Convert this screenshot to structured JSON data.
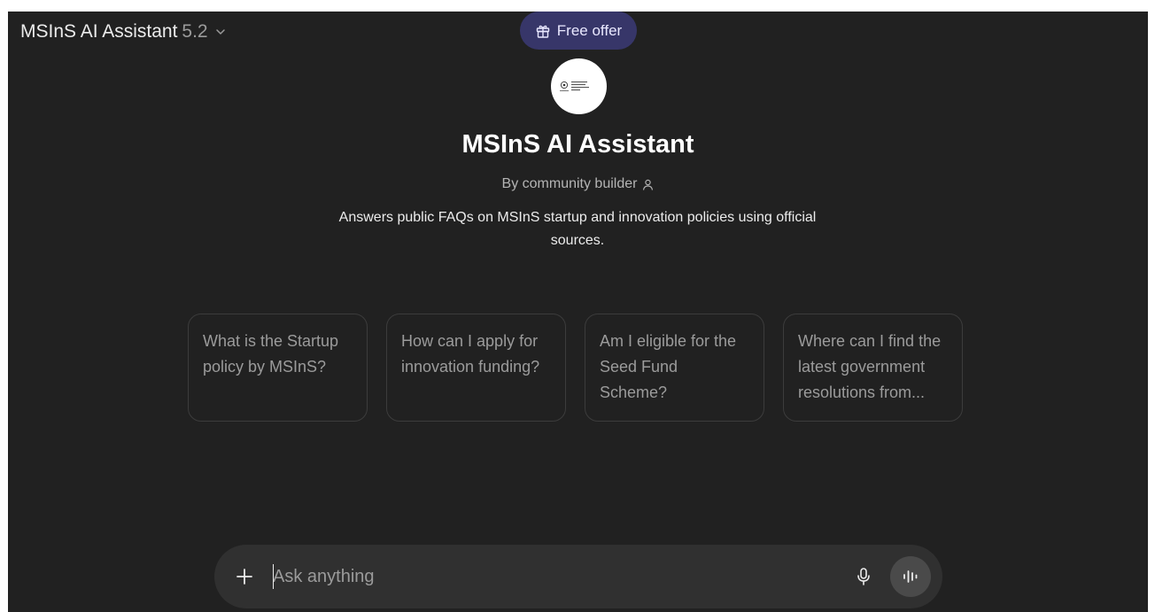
{
  "header": {
    "model_name": "MSInS AI Assistant",
    "model_version": "5.2",
    "free_offer_label": "Free offer"
  },
  "assistant": {
    "title": "MSInS AI Assistant",
    "byline": "By community builder",
    "description": "Answers public FAQs on MSInS startup and innovation policies using official sources."
  },
  "suggestions": [
    "What is the Startup policy by MSInS?",
    "How can I apply for innovation funding?",
    "Am I eligible for the Seed Fund Scheme?",
    "Where can I find the latest government resolutions from..."
  ],
  "composer": {
    "placeholder": "Ask anything"
  },
  "colors": {
    "background": "#212121",
    "offer_pill": "#373669",
    "composer": "#303030"
  }
}
